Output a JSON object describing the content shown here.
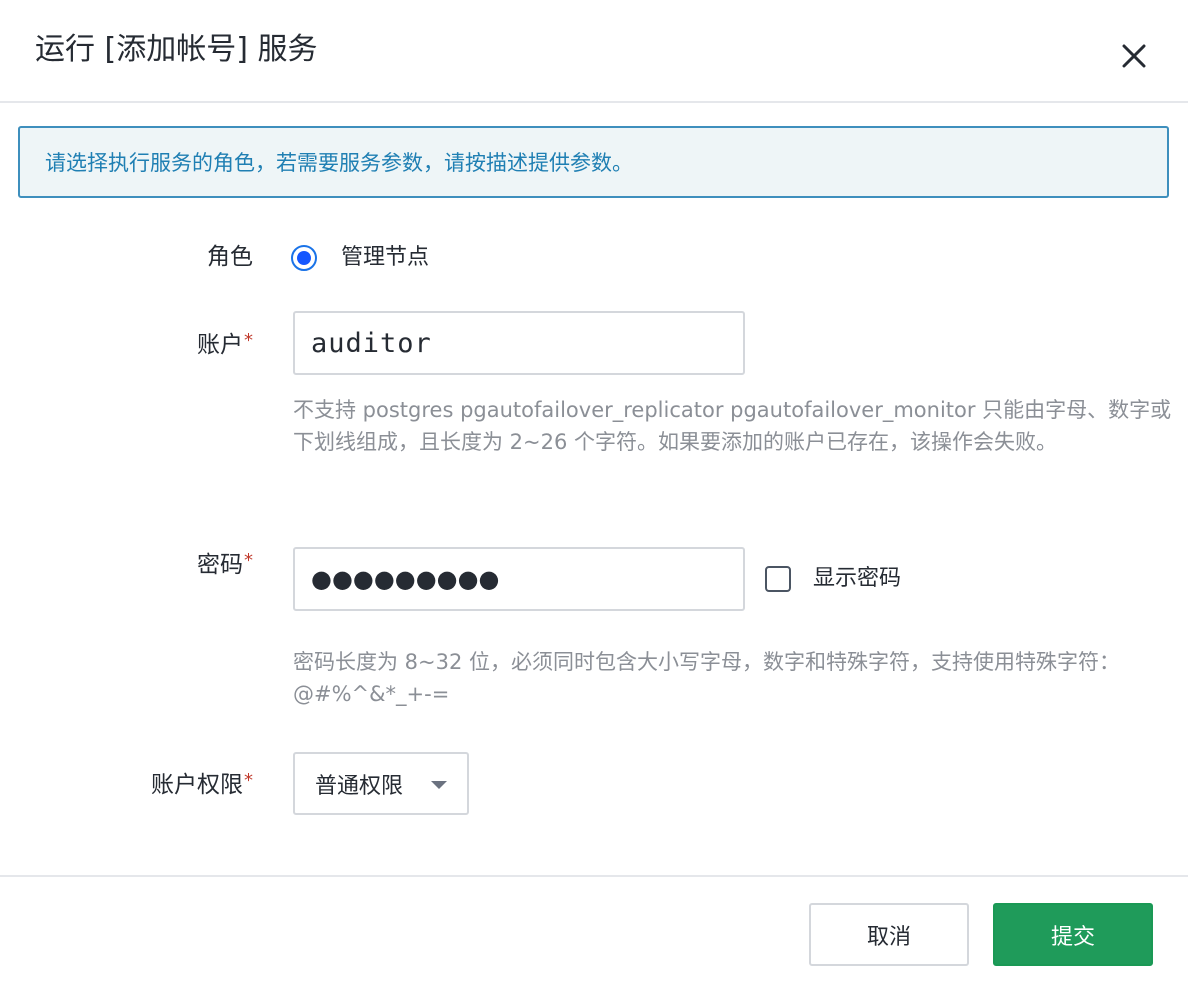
{
  "dialog": {
    "title": "运行 [添加帐号] 服务",
    "close_icon": "close-icon"
  },
  "info": {
    "text": "请选择执行服务的角色，若需要服务参数，请按描述提供参数。"
  },
  "form": {
    "role": {
      "label": "角色",
      "option_label": "管理节点",
      "selected": true
    },
    "account": {
      "label": "账户",
      "required_mark": "*",
      "value": "auditor",
      "help": "不支持 postgres pgautofailover_replicator pgautofailover_monitor 只能由字母、数字或下划线组成，且长度为 2~26 个字符。如果要添加的账户已存在，该操作会失败。"
    },
    "password": {
      "label": "密码",
      "required_mark": "*",
      "masked_value": "●●●●●●●●●",
      "show_label": "显示密码",
      "show_checked": false,
      "help": "密码长度为 8~32 位，必须同时包含大小写字母，数字和特殊字符，支持使用特殊字符：@#%^&*_+-="
    },
    "permission": {
      "label": "账户权限",
      "required_mark": "*",
      "selected_value": "普通权限"
    }
  },
  "footer": {
    "cancel_label": "取消",
    "submit_label": "提交"
  },
  "colors": {
    "info_border": "#3e8fbd",
    "info_text": "#1f7fb3",
    "radio_accent": "#1557ff",
    "required": "#c0392b",
    "submit_bg": "#1f9b5a"
  }
}
